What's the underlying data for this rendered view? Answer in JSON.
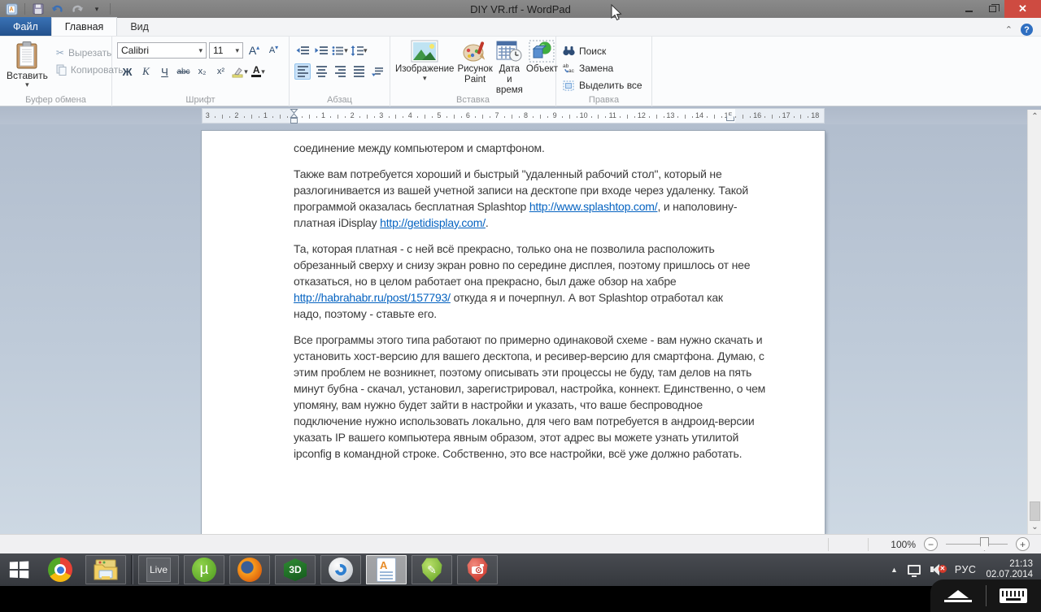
{
  "window": {
    "title": "DIY VR.rtf - WordPad"
  },
  "tabs": {
    "file": "Файл",
    "home": "Главная",
    "view": "Вид"
  },
  "ribbon": {
    "clipboard_group": "Буфер обмена",
    "paste": "Вставить",
    "cut": "Вырезать",
    "copy": "Копировать",
    "font_group": "Шрифт",
    "font_family": "Calibri",
    "font_size": "11",
    "bold": "Ж",
    "italic": "К",
    "underline": "Ч",
    "strike": "abc",
    "subscript": "x₂",
    "superscript": "x²",
    "paragraph_group": "Абзац",
    "insert_group": "Вставка",
    "image": "Изображение",
    "paint_line1": "Рисунок",
    "paint_line2": "Paint",
    "datetime_line1": "Дата и",
    "datetime_line2": "время",
    "object": "Объект",
    "edit_group": "Правка",
    "find": "Поиск",
    "replace": "Замена",
    "select_all": "Выделить все"
  },
  "ruler": {
    "left_numbers": [
      "3",
      "2",
      "1"
    ],
    "numbers": [
      "1",
      "2",
      "3",
      "4",
      "5",
      "6",
      "7",
      "8",
      "9",
      "10",
      "11",
      "12",
      "13",
      "14",
      "15",
      "16",
      "17",
      "18"
    ]
  },
  "document": {
    "paragraphs": [
      [
        [
          {
            "text": "соединение между компьютером и смартфоном."
          }
        ]
      ],
      [
        [
          {
            "text": "Также вам потребуется хороший и быстрый \"удаленный рабочий стол\", который не"
          }
        ],
        [
          {
            "text": "разлогинивается из вашей учетной записи на десктопе при входе через удаленку. Такой"
          }
        ],
        [
          {
            "text": "программой оказалась бесплатная Splashtop "
          },
          {
            "text": "http://www.splashtop.com/",
            "link": true
          },
          {
            "text": ", и наполовину-"
          }
        ],
        [
          {
            "text": "платная iDisplay "
          },
          {
            "text": "http://getidisplay.com/",
            "link": true
          },
          {
            "text": "."
          }
        ]
      ],
      [
        [
          {
            "text": "Та, которая платная - с ней всё прекрасно, только она не позволила расположить"
          }
        ],
        [
          {
            "text": "обрезанный сверху и снизу экран ровно по середине дисплея, поэтому пришлось от нее"
          }
        ],
        [
          {
            "text": "отказаться, но в целом работает она прекрасно, был даже обзор на хабре"
          }
        ],
        [
          {
            "text": "http://habrahabr.ru/post/157793/",
            "link": true
          },
          {
            "text": " откуда я и почерпнул. А вот Splashtop отработал как"
          }
        ],
        [
          {
            "text": "надо, поэтому - ставьте его."
          }
        ]
      ],
      [
        [
          {
            "text": "Все программы этого типа работают по примерно одинаковой схеме - вам нужно скачать и"
          }
        ],
        [
          {
            "text": "установить хост-версию для вашего десктопа, и ресивер-версию для смартфона. Думаю, с"
          }
        ],
        [
          {
            "text": "этим проблем не возникнет, поэтому описывать эти процессы не буду, там делов на пять"
          }
        ],
        [
          {
            "text": "минут бубна - скачал, установил, зарегистрировал, настройка, коннект. Единственно, о чем"
          }
        ],
        [
          {
            "text": "упомяну, вам нужно будет зайти в настройки и указать, что ваше беспроводное"
          }
        ],
        [
          {
            "text": "подключение нужно использовать локально, для чего вам потребуется в андроид-версии"
          }
        ],
        [
          {
            "text": "указать IP вашего компьютера явным образом, этот адрес вы можете узнать утилитой"
          }
        ],
        [
          {
            "text": "ipconfig в командной строке. Собственно, это все настройки, всё уже должно работать."
          }
        ]
      ]
    ]
  },
  "status": {
    "zoom_level": "100%"
  },
  "taskbar": {
    "live_label": "Live",
    "utorrent_glyph": "µ",
    "cube_glyph": "3D",
    "tray": {
      "lang": "РУС",
      "time": "21:13",
      "date": "02.07.2014"
    }
  },
  "colors": {
    "accent_blue": "#2a61a5",
    "link_blue": "#0563c1",
    "close_red": "#ce4b41",
    "title_gray": "#7f7f7f",
    "taskbar_dark": "#3a3d43",
    "workspace_blue_gray": "#bfcbd9"
  }
}
